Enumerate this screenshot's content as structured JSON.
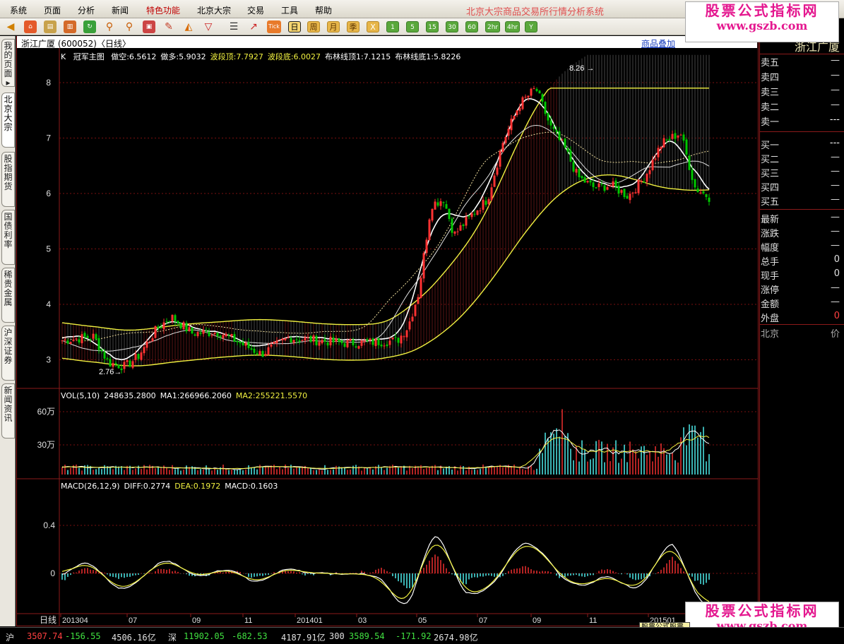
{
  "menu": {
    "items": [
      "系统",
      "页面",
      "分析",
      "新闻",
      "特色功能",
      "北京大宗",
      "交易",
      "工具",
      "帮助"
    ],
    "highlight_index": 4,
    "system_title": "北京大宗商品交易所行情分析系统"
  },
  "toolbar": {
    "icons": [
      "back-icon",
      "home-icon",
      "folder-icon",
      "chart-icon",
      "refresh-icon",
      "zoom-in-icon",
      "zoom-out-icon",
      "window-icon",
      "pen-icon",
      "draw-icon",
      "filter-icon"
    ],
    "tick_label": "Tick",
    "periods": [
      "日",
      "周",
      "月",
      "季",
      "X",
      "1",
      "5",
      "15",
      "30",
      "60",
      "2hr",
      "4hr",
      "Y"
    ],
    "selected_period": "日"
  },
  "watermark": {
    "name": "股票公式指标网",
    "url": "www.gszb.com"
  },
  "left_tabs": [
    "我的页面▸",
    "北京大宗",
    "股指期货",
    "国债利率",
    "稀贵金属",
    "沪深证券",
    "新闻资讯"
  ],
  "chart": {
    "title": "浙江广厦 (600052)〈日线〉",
    "overlay_link": "商品叠加",
    "ylabels": [
      "8",
      "7",
      "6",
      "5",
      "4",
      "3"
    ],
    "max_label": "8.26",
    "min_label": "2.76",
    "main_indicator": {
      "prefix": "K",
      "name": "冠军主图",
      "items": [
        {
          "text": "做空:6.5612",
          "color": "#ffffff"
        },
        {
          "text": "做多:5.9032",
          "color": "#ffffff"
        },
        {
          "text": "波段顶:7.7927",
          "color": "#f0f040"
        },
        {
          "text": "波段底:6.0027",
          "color": "#f0f040"
        },
        {
          "text": "布林线顶1:7.1215",
          "color": "#ffffff"
        },
        {
          "text": "布林线底1:5.8226",
          "color": "#ffffff"
        }
      ]
    },
    "vol_indicator": {
      "items": [
        {
          "text": "VOL(5,10)",
          "color": "#ffffff"
        },
        {
          "text": "248635.2800",
          "color": "#ffffff"
        },
        {
          "text": "MA1:266966.2060",
          "color": "#ffffff"
        },
        {
          "text": "MA2:255221.5570",
          "color": "#f0f040"
        }
      ],
      "ylabels": [
        "60万",
        "30万"
      ]
    },
    "macd_indicator": {
      "items": [
        {
          "text": "MACD(26,12,9)",
          "color": "#ffffff"
        },
        {
          "text": "DIFF:0.2774",
          "color": "#ffffff"
        },
        {
          "text": "DEA:0.1972",
          "color": "#f0f040"
        },
        {
          "text": "MACD:0.1603",
          "color": "#ffffff"
        }
      ],
      "ylabels": [
        "0.4",
        "0"
      ]
    },
    "xaxis": {
      "label": "日线",
      "ticks": [
        "201304",
        "07",
        "09",
        "11",
        "201401",
        "03",
        "05",
        "07",
        "09",
        "11",
        "201501"
      ]
    },
    "colors": {
      "up": "#ff3232",
      "down": "#54fcfc",
      "green_candle": "#00c800",
      "band": "#f0f040",
      "grid": "#7a0f0f"
    }
  },
  "quote": {
    "name": "浙江广厦",
    "sell": [
      {
        "label": "卖五",
        "value": "—"
      },
      {
        "label": "卖四",
        "value": "—"
      },
      {
        "label": "卖三",
        "value": "—"
      },
      {
        "label": "卖二",
        "value": "—"
      },
      {
        "label": "卖一",
        "value": "---"
      }
    ],
    "buy": [
      {
        "label": "买一",
        "value": "---"
      },
      {
        "label": "买二",
        "value": "—"
      },
      {
        "label": "买三",
        "value": "—"
      },
      {
        "label": "买四",
        "value": "—"
      },
      {
        "label": "买五",
        "value": "—"
      }
    ],
    "stats": [
      {
        "label": "最新",
        "value": "—"
      },
      {
        "label": "涨跌",
        "value": "—"
      },
      {
        "label": "幅度",
        "value": "—"
      },
      {
        "label": "总手",
        "value": "0"
      },
      {
        "label": "现手",
        "value": "0"
      },
      {
        "label": "涨停",
        "value": "—"
      },
      {
        "label": "金额",
        "value": "—"
      },
      {
        "label": "外盘",
        "value": "0"
      }
    ],
    "footer_left": "北京",
    "footer_right": "价"
  },
  "status": [
    {
      "text": "沪",
      "color": "#e0e0e0"
    },
    {
      "text": "3507.74",
      "color": "#ff4040"
    },
    {
      "text": "-156.55",
      "color": "#40e040"
    },
    {
      "text": "4506.16亿",
      "color": "#e0e0e0"
    },
    {
      "text": "深",
      "color": "#e0e0e0"
    },
    {
      "text": "11902.05",
      "color": "#40e040"
    },
    {
      "text": "-682.53",
      "color": "#40e040"
    },
    {
      "text": "4187.91亿",
      "color": "#e0e0e0"
    },
    {
      "text": "300",
      "color": "#e0e0e0"
    },
    {
      "text": "3589.54",
      "color": "#40e040"
    },
    {
      "text": "-171.92",
      "color": "#40e040"
    },
    {
      "text": "2674.98亿",
      "color": "#e0e0e0"
    }
  ],
  "bottom_tooltip": "股票公式股票"
}
